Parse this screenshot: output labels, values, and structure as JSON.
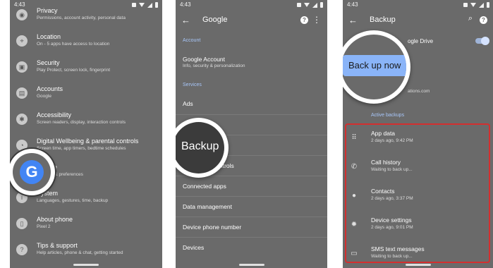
{
  "status": {
    "time": "4:43"
  },
  "settings": {
    "items": [
      {
        "title": "Privacy",
        "sub": "Permissions, account activity, personal data",
        "icon": "privacy-icon"
      },
      {
        "title": "Location",
        "sub": "On - 5 apps have access to location",
        "icon": "location-icon"
      },
      {
        "title": "Security",
        "sub": "Play Protect, screen lock, fingerprint",
        "icon": "lock-icon"
      },
      {
        "title": "Accounts",
        "sub": "Google",
        "icon": "accounts-icon"
      },
      {
        "title": "Accessibility",
        "sub": "Screen readers, display, interaction controls",
        "icon": "accessibility-icon"
      },
      {
        "title": "Digital Wellbeing & parental controls",
        "sub": "Screen time, app timers, bedtime schedules",
        "icon": "wellbeing-icon"
      },
      {
        "title": "Google",
        "sub": "Services & preferences",
        "icon": "google-icon"
      },
      {
        "title": "System",
        "sub": "Languages, gestures, time, backup",
        "icon": "info-icon"
      },
      {
        "title": "About phone",
        "sub": "Pixel 2",
        "icon": "phone-icon"
      },
      {
        "title": "Tips & support",
        "sub": "Help articles, phone & chat, getting started",
        "icon": "help-icon"
      }
    ],
    "magnifier_glyph": "G",
    "google_title_visible": "ogle",
    "google_sub_visible": "ices & preferences"
  },
  "google": {
    "title": "Google",
    "section_account": "Account",
    "account_title": "Google Account",
    "account_sub": "Info, security & personalization",
    "section_services": "Services",
    "rows": [
      "Ads",
      "",
      "",
      "ntrols",
      "Connected apps",
      "Data management",
      "Device phone number",
      "Devices"
    ],
    "magnifier_label": "Backup"
  },
  "backup": {
    "title": "Backup",
    "gdrive_label": "ogle Drive",
    "account_tail": "ations.com",
    "backup_now_label": "Back up now",
    "active_label": "Active backups",
    "items": [
      {
        "title": "App data",
        "sub": "2 days ago, 9:42 PM",
        "icon": "apps-grid-icon"
      },
      {
        "title": "Call history",
        "sub": "Waiting to back up...",
        "icon": "phone-icon"
      },
      {
        "title": "Contacts",
        "sub": "2 days ago, 3:37 PM",
        "icon": "person-icon"
      },
      {
        "title": "Device settings",
        "sub": "2 days ago, 9:01 PM",
        "icon": "gear-icon"
      },
      {
        "title": "SMS text messages",
        "sub": "Waiting to back up...",
        "icon": "message-icon"
      }
    ]
  },
  "colors": {
    "panel_bg": "#6a6a6a",
    "accent": "#a8c7fa",
    "highlight": "#d32f2f",
    "button": "#8ab4f8"
  }
}
